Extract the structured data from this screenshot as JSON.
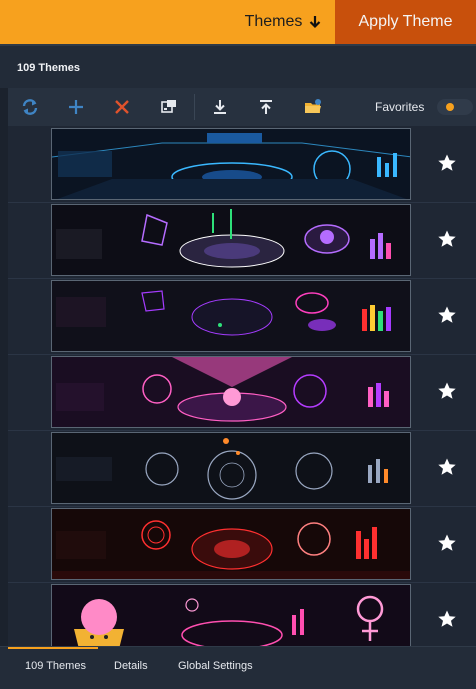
{
  "header": {
    "themes_label": "Themes",
    "apply_label": "Apply Theme"
  },
  "title": {
    "count_label": "109 Themes"
  },
  "toolbar": {
    "icons": [
      "refresh-icon",
      "add-icon",
      "delete-icon",
      "edit-icon",
      "download-icon",
      "upload-icon",
      "open-folder-icon"
    ],
    "favorites_label": "Favorites"
  },
  "themes": [
    {
      "id": 1,
      "palette": [
        "#0b1422",
        "#3ab8ff",
        "#1f6fd0"
      ]
    },
    {
      "id": 2,
      "palette": [
        "#0d0d16",
        "#b56cff",
        "#ffffff"
      ]
    },
    {
      "id": 3,
      "palette": [
        "#10101a",
        "#a53cff",
        "#ff3fbf"
      ]
    },
    {
      "id": 4,
      "palette": [
        "#1a0d22",
        "#ff5fc4",
        "#b53cff"
      ]
    },
    {
      "id": 5,
      "palette": [
        "#0e1118",
        "#9aa8c2",
        "#ff8a2a"
      ]
    },
    {
      "id": 6,
      "palette": [
        "#160808",
        "#ff3030",
        "#ff8080"
      ]
    },
    {
      "id": 7,
      "palette": [
        "#120a18",
        "#ff4fb0",
        "#ff9ad6"
      ]
    }
  ],
  "tabs": {
    "themes": "109 Themes",
    "details": "Details",
    "global": "Global Settings"
  },
  "colors": {
    "accent": "#f7a11e",
    "apply": "#c8500c",
    "background": "#1f2734"
  }
}
